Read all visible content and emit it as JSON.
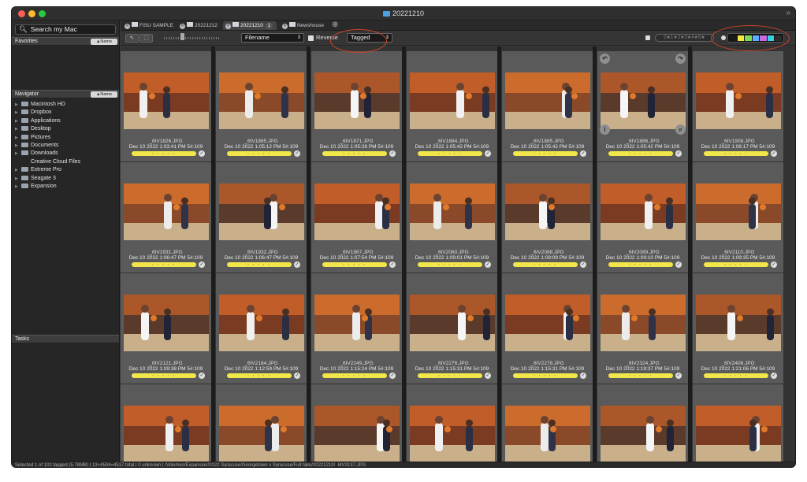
{
  "window": {
    "title": "20221210"
  },
  "sidebar": {
    "search_placeholder": "Search my Mac",
    "favorites": {
      "title": "Favorites",
      "sort_label": "▲Name"
    },
    "navigator": {
      "title": "Navigator",
      "sort_label": "▲Name",
      "items": [
        {
          "label": "Macintosh HD"
        },
        {
          "label": "Dropbox"
        },
        {
          "label": "Applications"
        },
        {
          "label": "Desktop"
        },
        {
          "label": "Pictures"
        },
        {
          "label": "Documents"
        },
        {
          "label": "Downloads"
        },
        {
          "label": "Creative Cloud Files"
        },
        {
          "label": "Extreme Pro"
        },
        {
          "label": "Seagate 3"
        },
        {
          "label": "Expansion"
        }
      ]
    },
    "tasks": {
      "title": "Tasks"
    }
  },
  "tabs": [
    {
      "label": "FISU SAMPLE"
    },
    {
      "label": "20221212"
    },
    {
      "label": "20221210",
      "count": "1"
    },
    {
      "label": "Newshouse"
    }
  ],
  "toolbar": {
    "sort_value": "Filename",
    "reverse_label": "Reverse",
    "filter_value": "Tagged",
    "stars_text": "0★1★2★3★4★5★"
  },
  "colors": {
    "accent_ring": "#d0452a",
    "tag_yellow": "#f1e64a",
    "swatches": [
      "#1a1a1a",
      "#f0ea3c",
      "#7ed957",
      "#5ab0ff",
      "#c46be0",
      "#39d0e0",
      "#2c2c2c"
    ]
  },
  "grid": {
    "rows": [
      [
        {
          "file": "_6IV1826.JPG",
          "meta": "Dec 10 2022 1:03:41 PM 5#:109"
        },
        {
          "file": "_6IV1865.JPG",
          "meta": "Dec 10 2022 1:05:12 PM 5#:109"
        },
        {
          "file": "_6IV1871.JPG",
          "meta": "Dec 10 2022 1:05:28 PM 5#:109"
        },
        {
          "file": "_6IV1884.JPG",
          "meta": "Dec 10 2022 1:05:42 PM 5#:109"
        },
        {
          "file": "_6IV1885.JPG",
          "meta": "Dec 10 2022 1:05:42 PM 5#:109"
        },
        {
          "file": "_6IV1886.JPG",
          "meta": "Dec 10 2022 1:05:42 PM 5#:109"
        },
        {
          "file": "_6IV1908.JPG",
          "meta": "Dec 10 2022 1:06:17 PM 5#:109"
        }
      ],
      [
        {
          "file": "_6IV1931.JPG",
          "meta": "Dec 10 2022 1:06:47 PM 5#:109"
        },
        {
          "file": "_6IV1932.JPG",
          "meta": "Dec 10 2022 1:06:47 PM 5#:109"
        },
        {
          "file": "_6IV1967.JPG",
          "meta": "Dec 10 2022 1:07:54 PM 5#:109"
        },
        {
          "file": "_6IV2080.JPG",
          "meta": "Dec 10 2022 1:09:01 PM 5#:109"
        },
        {
          "file": "_6IV2088.JPG",
          "meta": "Dec 10 2022 1:09:09 PM 5#:109"
        },
        {
          "file": "_6IV2089.JPG",
          "meta": "Dec 10 2022 1:09:10 PM 5#:109"
        },
        {
          "file": "_6IV2110.JPG",
          "meta": "Dec 10 2022 1:09:35 PM 5#:109"
        }
      ],
      [
        {
          "file": "_6IV2121.JPG",
          "meta": "Dec 10 2022 1:09:38 PM 5#:109"
        },
        {
          "file": "_6IV2184.JPG",
          "meta": "Dec 10 2022 1:12:59 PM 5#:109"
        },
        {
          "file": "_6IV2249.JPG",
          "meta": "Dec 10 2022 1:15:24 PM 5#:109"
        },
        {
          "file": "_6IV2276.JPG",
          "meta": "Dec 10 2022 1:15:31 PM 5#:109"
        },
        {
          "file": "_6IV2278.JPG",
          "meta": "Dec 10 2022 1:15:31 PM 5#:109"
        },
        {
          "file": "_6IV2324.JPG",
          "meta": "Dec 10 2022 1:19:37 PM 5#:109"
        },
        {
          "file": "_6IV2406.JPG",
          "meta": "Dec 10 2022 1:21:06 PM 5#:109"
        }
      ],
      [
        {
          "file": "",
          "meta": ""
        },
        {
          "file": "",
          "meta": ""
        },
        {
          "file": "",
          "meta": ""
        },
        {
          "file": "",
          "meta": ""
        },
        {
          "file": "",
          "meta": ""
        },
        {
          "file": "",
          "meta": ""
        },
        {
          "file": "",
          "meta": ""
        }
      ]
    ]
  },
  "status": {
    "text": "Selected 1 of 102 tagged (5.78MB) | 13+4504=4517 total | 0 unknown | /Volumes/Expansion/2022 Syracuse/Georgetown v Syracuse/Full take/20221210/_6IV3137.JPG"
  }
}
